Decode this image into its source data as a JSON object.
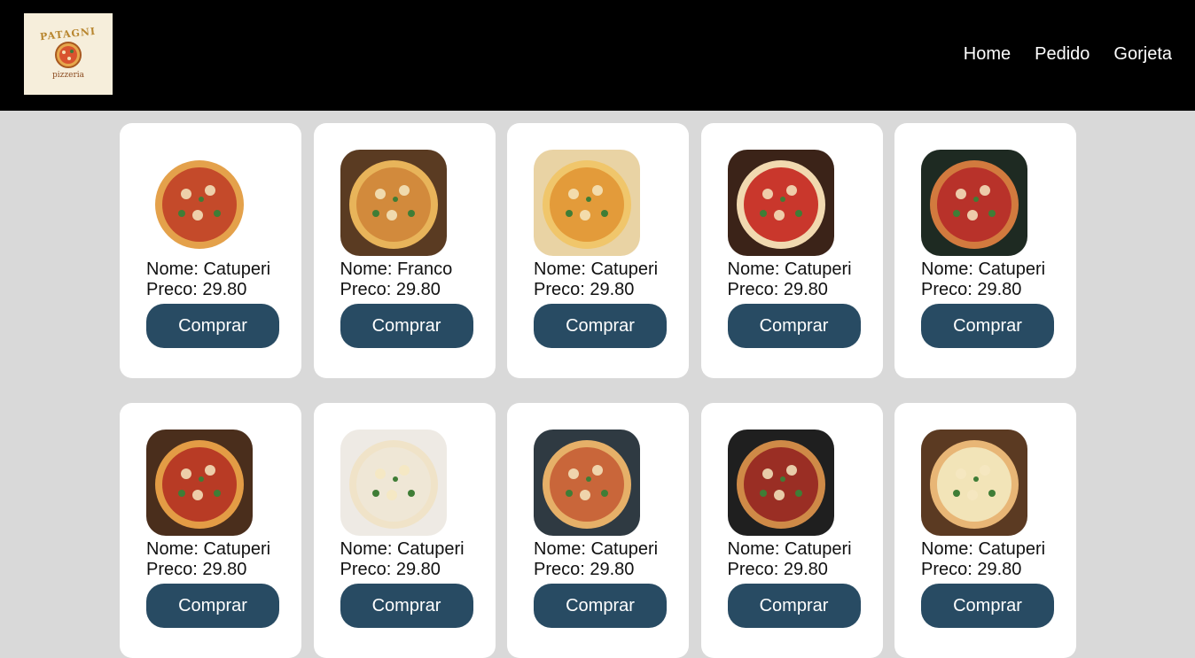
{
  "header": {
    "logo_name": "PATAGNI",
    "logo_sub": "pizzeria",
    "nav": [
      {
        "label": "Home"
      },
      {
        "label": "Pedido"
      },
      {
        "label": "Gorjeta"
      }
    ]
  },
  "labels": {
    "name_prefix": "Nome: ",
    "price_prefix": "Preco: "
  },
  "products": [
    {
      "name": "Catuperi",
      "price": "29.80",
      "button": "Comprar",
      "crust": "#e4a14b",
      "top": "#c44a2a"
    },
    {
      "name": "Franco",
      "price": "29.80",
      "button": "Comprar",
      "crust": "#e8b45a",
      "top": "#d28a3c"
    },
    {
      "name": "Catuperi",
      "price": "29.80",
      "button": "Comprar",
      "crust": "#f0c66b",
      "top": "#e39b3a"
    },
    {
      "name": "Catuperi",
      "price": "29.80",
      "button": "Comprar",
      "crust": "#f1d9b0",
      "top": "#c9372c"
    },
    {
      "name": "Catuperi",
      "price": "29.80",
      "button": "Comprar",
      "crust": "#d27a3e",
      "top": "#b8322a"
    },
    {
      "name": "Catuperi",
      "price": "29.80",
      "button": "Comprar",
      "crust": "#e39c45",
      "top": "#b83b25"
    },
    {
      "name": "Catuperi",
      "price": "29.80",
      "button": "Comprar",
      "crust": "#f0e3c8",
      "top": "#efe7d6"
    },
    {
      "name": "Catuperi",
      "price": "29.80",
      "button": "Comprar",
      "crust": "#e6b068",
      "top": "#c9663a"
    },
    {
      "name": "Catuperi",
      "price": "29.80",
      "button": "Comprar",
      "crust": "#cf8a47",
      "top": "#9a2e24"
    },
    {
      "name": "Catuperi",
      "price": "29.80",
      "button": "Comprar",
      "crust": "#e8b676",
      "top": "#f2e4b8"
    }
  ],
  "thumb_backgrounds": [
    "#ffffff",
    "#5a3b22",
    "#e9d3a4",
    "#3b2318",
    "#1e2a22",
    "#4a2e1c",
    "#eeeae4",
    "#2f3a42",
    "#1f1f1f",
    "#5b3a22"
  ]
}
